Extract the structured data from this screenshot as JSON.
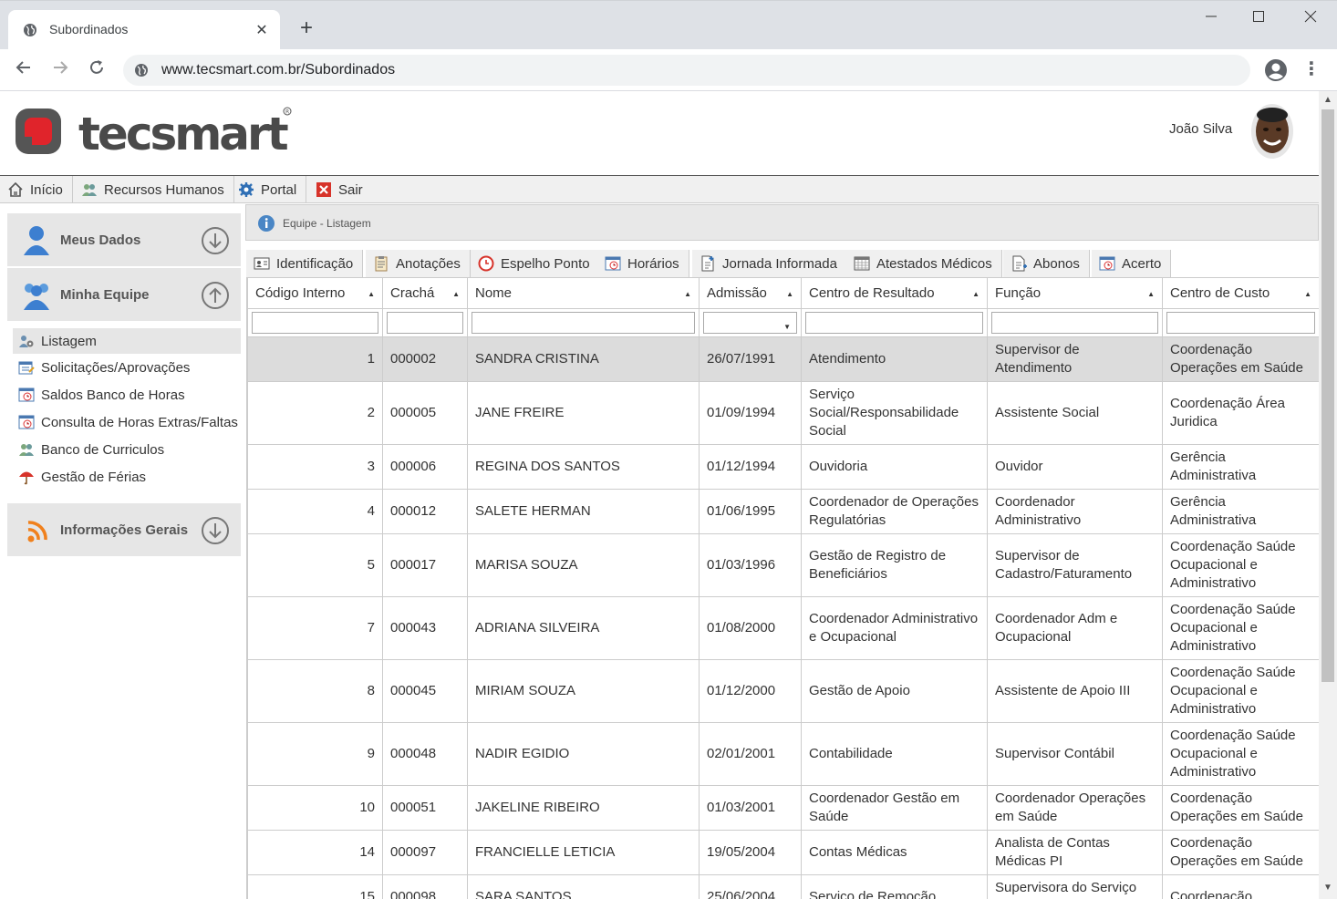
{
  "browser": {
    "tab_title": "Subordinados",
    "url": "www.tecsmart.com.br/Subordinados"
  },
  "header": {
    "logo_text": "tecsmart",
    "user_name": "João Silva"
  },
  "menu": [
    {
      "label": "Início",
      "icon": "home-icon"
    },
    {
      "label": "Recursos Humanos",
      "icon": "people-icon"
    },
    {
      "label": "Portal",
      "icon": "gear-icon"
    },
    {
      "label": "Sair",
      "icon": "exit-icon"
    }
  ],
  "sidebar": {
    "meus_dados": "Meus Dados",
    "minha_equipe": "Minha Equipe",
    "informacoes_gerais": "Informações Gerais",
    "items": [
      {
        "label": "Listagem",
        "icon": "team-gear-icon"
      },
      {
        "label": "Solicitações/Aprovações",
        "icon": "calendar-edit-icon"
      },
      {
        "label": "Saldos Banco de Horas",
        "icon": "calendar-clock-icon"
      },
      {
        "label": "Consulta de Horas Extras/Faltas",
        "icon": "calendar-clock-icon"
      },
      {
        "label": "Banco de Curriculos",
        "icon": "people-icon"
      },
      {
        "label": "Gestão de Férias",
        "icon": "umbrella-icon"
      }
    ]
  },
  "breadcrumb": "Equipe - Listagem",
  "toolbar": [
    {
      "label": "Identificação",
      "icon": "id-card-icon"
    },
    {
      "label": "Anotações",
      "icon": "clipboard-icon"
    },
    {
      "label": "Espelho Ponto",
      "icon": "clock-icon"
    },
    {
      "label": "Horários",
      "icon": "calendar-clock-icon"
    },
    {
      "label": "Jornada Informada",
      "icon": "document-add-icon"
    },
    {
      "label": "Atestados Médicos",
      "icon": "calendar-grid-icon"
    },
    {
      "label": "Abonos",
      "icon": "document-add-icon"
    },
    {
      "label": "Acerto",
      "icon": "calendar-clock-icon"
    }
  ],
  "table": {
    "columns": [
      "Código Interno",
      "Crachá",
      "Nome",
      "Admissão",
      "Centro de Resultado",
      "Função",
      "Centro de Custo"
    ],
    "rows": [
      [
        "1",
        "000002",
        "SANDRA CRISTINA",
        "26/07/1991",
        "Atendimento",
        "Supervisor de Atendimento",
        "Coordenação Operações em Saúde"
      ],
      [
        "2",
        "000005",
        "JANE FREIRE",
        "01/09/1994",
        "Serviço Social/Responsabilidade Social",
        "Assistente Social",
        "Coordenação Área Juridica"
      ],
      [
        "3",
        "000006",
        "REGINA DOS SANTOS",
        "01/12/1994",
        "Ouvidoria",
        "Ouvidor",
        "Gerência Administrativa"
      ],
      [
        "4",
        "000012",
        "SALETE HERMAN",
        "01/06/1995",
        "Coordenador de Operações Regulatórias",
        "Coordenador Administrativo",
        "Gerência Administrativa"
      ],
      [
        "5",
        "000017",
        "MARISA SOUZA",
        "01/03/1996",
        "Gestão de Registro de Beneficiários",
        "Supervisor de Cadastro/Faturamento",
        "Coordenação Saúde Ocupacional e Administrativo"
      ],
      [
        "7",
        "000043",
        "ADRIANA SILVEIRA",
        "01/08/2000",
        "Coordenador Administrativo e Ocupacional",
        "Coordenador Adm e Ocupacional",
        "Coordenação Saúde Ocupacional e Administrativo"
      ],
      [
        "8",
        "000045",
        "MIRIAM SOUZA",
        "01/12/2000",
        "Gestão de Apoio",
        "Assistente de Apoio III",
        "Coordenação Saúde Ocupacional e Administrativo"
      ],
      [
        "9",
        "000048",
        "NADIR EGIDIO",
        "02/01/2001",
        "Contabilidade",
        "Supervisor Contábil",
        "Coordenação Saúde Ocupacional e Administrativo"
      ],
      [
        "10",
        "000051",
        "JAKELINE RIBEIRO",
        "01/03/2001",
        "Coordenador Gestão em Saúde",
        "Coordenador Operações em Saúde",
        "Coordenação Operações em Saúde"
      ],
      [
        "14",
        "000097",
        "FRANCIELLE LETICIA",
        "19/05/2004",
        "Contas Médicas",
        "Analista de Contas Médicas PI",
        "Coordenação Operações em Saúde"
      ],
      [
        "15",
        "000098",
        "SARA SANTOS",
        "25/06/2004",
        "Serviço de Remoção",
        "Supervisora do Serviço de",
        "Coordenação"
      ]
    ]
  }
}
